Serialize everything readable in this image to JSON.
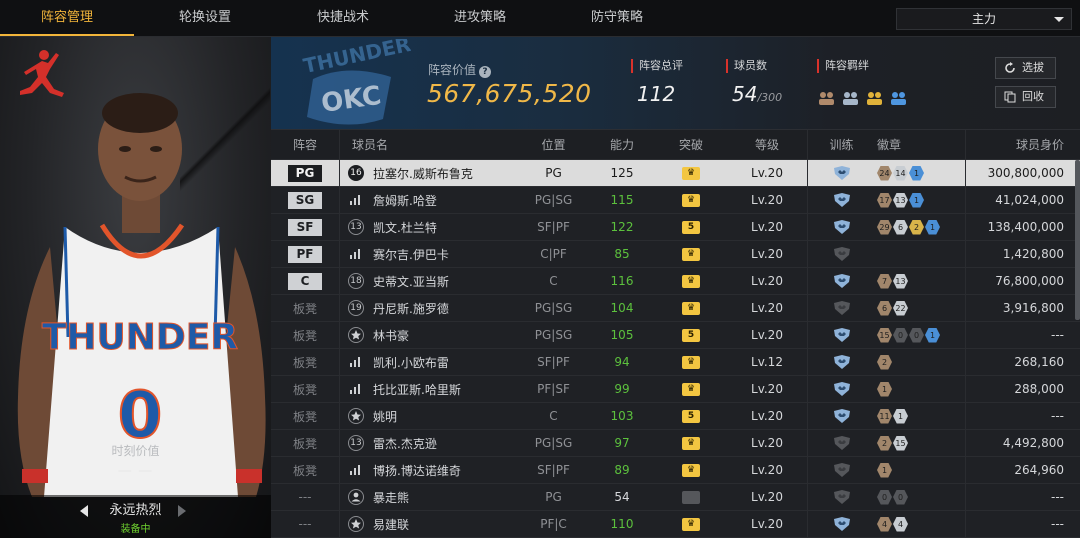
{
  "nav": {
    "tabs": [
      "阵容管理",
      "轮换设置",
      "快捷战术",
      "进攻策略",
      "防守策略"
    ],
    "active_tab": 0,
    "lineup_select": "主力"
  },
  "card": {
    "moment_label": "时刻价值",
    "moment_value": "— —",
    "skin_name": "永远热烈",
    "skin_status": "装备中"
  },
  "header": {
    "lineup_value_label": "阵容价值",
    "lineup_value": "567,675,520",
    "total_rating_label": "阵容总评",
    "total_rating": "112",
    "players_label": "球员数",
    "players_count": "54",
    "players_max": "/300",
    "bonds_label": "阵容羁绊",
    "select_button": "选拔",
    "recall_button": "回收"
  },
  "table": {
    "headers": [
      "阵容",
      "球员名",
      "位置",
      "能力",
      "突破",
      "等级",
      "训练",
      "徽章",
      "球员身价"
    ],
    "rows": [
      {
        "slot": "PG",
        "starter": true,
        "icon": "number",
        "num": "16",
        "name": "拉塞尔.威斯布鲁克",
        "position": "PG",
        "ability": "125",
        "ability_color": "normal",
        "break": "crown",
        "level": "Lv.20",
        "train": "blue",
        "badges": [
          {
            "n": "24",
            "c": "#a1866b"
          },
          {
            "n": "14",
            "c": "#c8cdd2"
          },
          {
            "n": "1",
            "c": "#4a8fd6"
          }
        ],
        "value": "300,800,000"
      },
      {
        "slot": "SG",
        "starter": true,
        "icon": "bars",
        "num": "",
        "name": "詹姆斯.哈登",
        "position": "PG|SG",
        "ability": "115",
        "ability_color": "green",
        "break": "crown",
        "level": "Lv.20",
        "train": "blue",
        "badges": [
          {
            "n": "17",
            "c": "#a1866b"
          },
          {
            "n": "13",
            "c": "#c8cdd2"
          },
          {
            "n": "1",
            "c": "#4a8fd6"
          }
        ],
        "value": "41,024,000"
      },
      {
        "slot": "SF",
        "starter": true,
        "icon": "number",
        "num": "13",
        "name": "凯文.杜兰特",
        "position": "SF|PF",
        "ability": "122",
        "ability_color": "green",
        "break": "5",
        "level": "Lv.20",
        "train": "blue",
        "badges": [
          {
            "n": "29",
            "c": "#a1866b"
          },
          {
            "n": "6",
            "c": "#c8cdd2"
          },
          {
            "n": "2",
            "c": "#d8b44a"
          },
          {
            "n": "1",
            "c": "#4a8fd6"
          }
        ],
        "value": "138,400,000"
      },
      {
        "slot": "PF",
        "starter": true,
        "icon": "bars",
        "num": "",
        "name": "赛尔吉.伊巴卡",
        "position": "C|PF",
        "ability": "85",
        "ability_color": "green",
        "break": "crown",
        "level": "Lv.20",
        "train": "gray",
        "badges": [],
        "value": "1,420,800"
      },
      {
        "slot": "C",
        "starter": true,
        "icon": "number",
        "num": "18",
        "name": "史蒂文.亚当斯",
        "position": "C",
        "ability": "116",
        "ability_color": "green",
        "break": "crown",
        "level": "Lv.20",
        "train": "blue",
        "badges": [
          {
            "n": "7",
            "c": "#a1866b"
          },
          {
            "n": "13",
            "c": "#c8cdd2"
          }
        ],
        "value": "76,800,000"
      },
      {
        "slot": "板凳",
        "starter": false,
        "icon": "number",
        "num": "19",
        "name": "丹尼斯.施罗德",
        "position": "PG|SG",
        "ability": "104",
        "ability_color": "green",
        "break": "crown",
        "level": "Lv.20",
        "train": "gray",
        "badges": [
          {
            "n": "6",
            "c": "#a1866b"
          },
          {
            "n": "22",
            "c": "#c8cdd2"
          }
        ],
        "value": "3,916,800"
      },
      {
        "slot": "板凳",
        "starter": false,
        "icon": "star",
        "num": "",
        "name": "林书豪",
        "position": "PG|SG",
        "ability": "105",
        "ability_color": "green",
        "break": "5",
        "level": "Lv.20",
        "train": "blue",
        "badges": [
          {
            "n": "15",
            "c": "#a1866b"
          },
          {
            "n": "0",
            "c": "#55575b"
          },
          {
            "n": "0",
            "c": "#55575b"
          },
          {
            "n": "1",
            "c": "#4a8fd6"
          }
        ],
        "value": "---"
      },
      {
        "slot": "板凳",
        "starter": false,
        "icon": "bars",
        "num": "",
        "name": "凯利.小欧布雷",
        "position": "SF|PF",
        "ability": "94",
        "ability_color": "green",
        "break": "crown",
        "level": "Lv.12",
        "train": "blue",
        "badges": [
          {
            "n": "2",
            "c": "#a1866b"
          }
        ],
        "value": "268,160"
      },
      {
        "slot": "板凳",
        "starter": false,
        "icon": "bars",
        "num": "",
        "name": "托比亚斯.哈里斯",
        "position": "PF|SF",
        "ability": "99",
        "ability_color": "green",
        "break": "crown",
        "level": "Lv.20",
        "train": "blue",
        "badges": [
          {
            "n": "1",
            "c": "#a1866b"
          }
        ],
        "value": "288,000"
      },
      {
        "slot": "板凳",
        "starter": false,
        "icon": "star",
        "num": "",
        "name": "姚明",
        "position": "C",
        "ability": "103",
        "ability_color": "green",
        "break": "5",
        "level": "Lv.20",
        "train": "blue",
        "badges": [
          {
            "n": "11",
            "c": "#a1866b"
          },
          {
            "n": "1",
            "c": "#c8cdd2"
          }
        ],
        "value": "---"
      },
      {
        "slot": "板凳",
        "starter": false,
        "icon": "number",
        "num": "13",
        "name": "雷杰.杰克逊",
        "position": "PG|SG",
        "ability": "97",
        "ability_color": "green",
        "break": "crown",
        "level": "Lv.20",
        "train": "gray",
        "badges": [
          {
            "n": "2",
            "c": "#a1866b"
          },
          {
            "n": "15",
            "c": "#c8cdd2"
          }
        ],
        "value": "4,492,800"
      },
      {
        "slot": "板凳",
        "starter": false,
        "icon": "bars",
        "num": "",
        "name": "博扬.博达诺维奇",
        "position": "SF|PF",
        "ability": "89",
        "ability_color": "green",
        "break": "crown",
        "level": "Lv.20",
        "train": "gray",
        "badges": [
          {
            "n": "1",
            "c": "#a1866b"
          }
        ],
        "value": "264,960"
      },
      {
        "slot": "---",
        "starter": false,
        "icon": "person",
        "num": "",
        "name": "暴走熊",
        "position": "PG",
        "ability": "54",
        "ability_color": "normal",
        "break": "off",
        "level": "Lv.20",
        "train": "gray",
        "badges": [
          {
            "n": "0",
            "c": "#55575b"
          },
          {
            "n": "0",
            "c": "#55575b"
          }
        ],
        "value": "---"
      },
      {
        "slot": "---",
        "starter": false,
        "icon": "star",
        "num": "",
        "name": "易建联",
        "position": "PF|C",
        "ability": "110",
        "ability_color": "green",
        "break": "crown",
        "level": "Lv.20",
        "train": "blue",
        "badges": [
          {
            "n": "4",
            "c": "#a1866b"
          },
          {
            "n": "4",
            "c": "#c8cdd2"
          }
        ],
        "value": "---"
      }
    ]
  },
  "colors": {
    "accent": "#f2b53a",
    "green": "#5cc13d",
    "selected_row": "#dcdcdc"
  }
}
